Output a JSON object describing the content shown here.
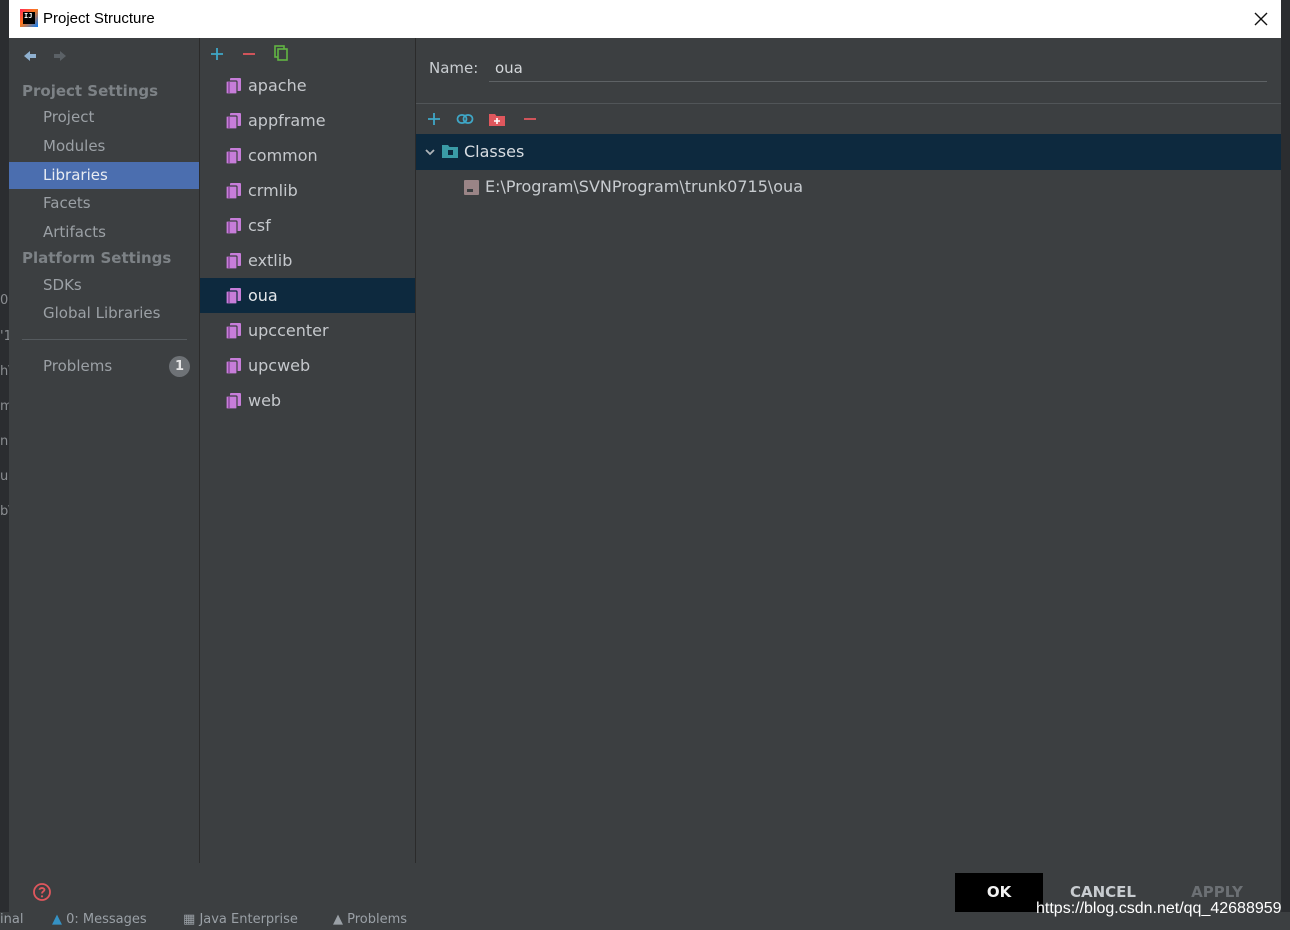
{
  "window": {
    "title": "Project Structure"
  },
  "nav": {
    "project_settings_header": "Project Settings",
    "platform_settings_header": "Platform Settings",
    "items": [
      {
        "label": "Project"
      },
      {
        "label": "Modules"
      },
      {
        "label": "Libraries",
        "selected": true
      },
      {
        "label": "Facets"
      },
      {
        "label": "Artifacts"
      },
      {
        "label": "SDKs"
      },
      {
        "label": "Global Libraries"
      },
      {
        "label": "Problems",
        "badge": "1"
      }
    ]
  },
  "libraries": {
    "toolbar": [
      "add-icon",
      "remove-icon",
      "copy-icon"
    ],
    "items": [
      {
        "label": "apache"
      },
      {
        "label": "appframe"
      },
      {
        "label": "common"
      },
      {
        "label": "crmlib"
      },
      {
        "label": "csf"
      },
      {
        "label": "extlib"
      },
      {
        "label": "oua",
        "selected": true
      },
      {
        "label": "upccenter"
      },
      {
        "label": "upcweb"
      },
      {
        "label": "web"
      }
    ]
  },
  "detail": {
    "name_label": "Name:",
    "name_value": "oua",
    "toolbar": [
      "add-icon",
      "link-icon",
      "add-folder-icon",
      "remove-icon"
    ],
    "tree": {
      "root_label": "Classes",
      "children": [
        {
          "label": "E:\\Program\\SVNProgram\\trunk0715\\oua"
        }
      ]
    }
  },
  "footer": {
    "ok": "OK",
    "cancel": "CANCEL",
    "apply": "APPLY",
    "watermark": "https://blog.csdn.net/qq_42688959"
  },
  "background": {
    "side_fragments": [
      "0",
      "'1",
      "h\\",
      "m",
      "n",
      "u",
      "b\\"
    ],
    "bottom_tabs": [
      "inal",
      "0: Messages",
      "Java Enterprise",
      "Problems"
    ]
  },
  "colors": {
    "accent_selection": "#4b6eaf",
    "tree_selection": "#0d293e",
    "library_icon": "#c77dd9",
    "add_icon": "#3fa7c7",
    "remove_icon": "#e0575d"
  }
}
